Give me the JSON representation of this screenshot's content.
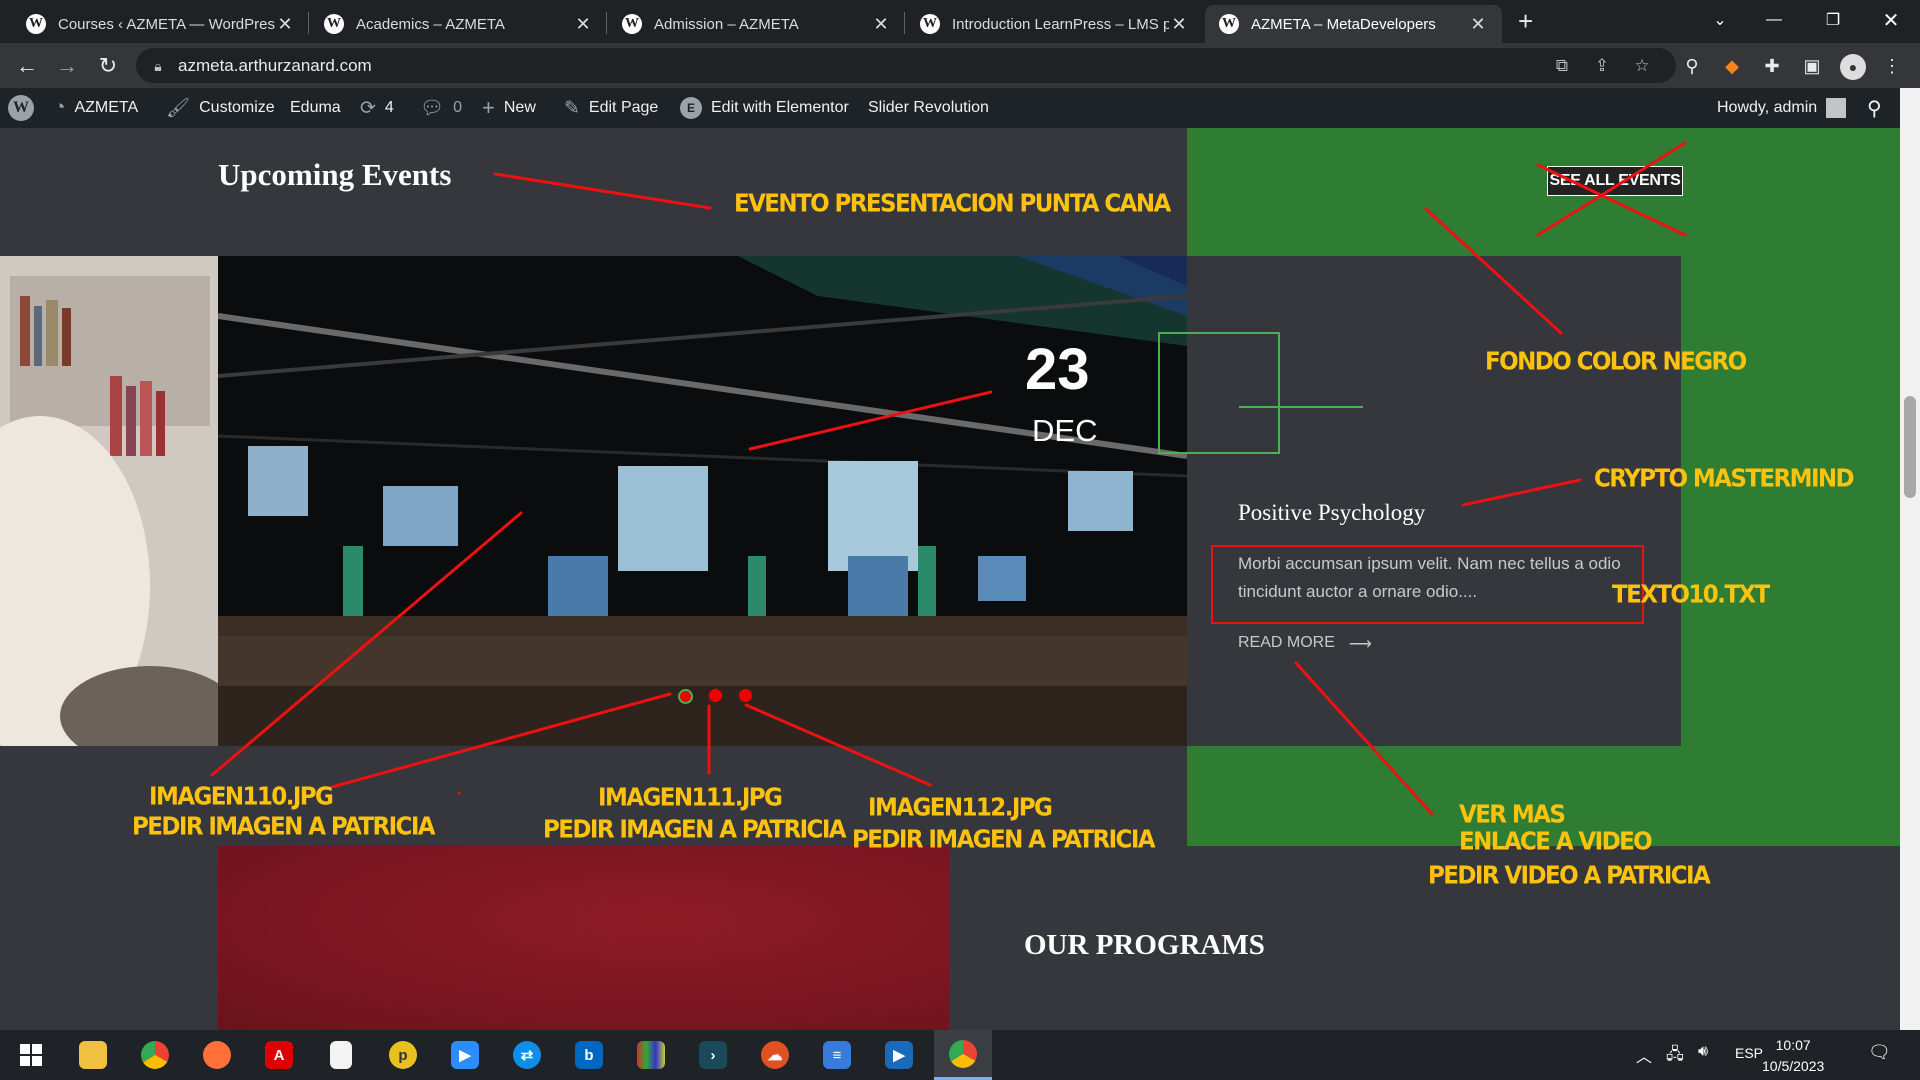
{
  "browser": {
    "tabs": [
      {
        "title": "Courses ‹ AZMETA — WordPress"
      },
      {
        "title": "Academics – AZMETA"
      },
      {
        "title": "Admission – AZMETA"
      },
      {
        "title": "Introduction LearnPress – LMS pl"
      },
      {
        "title": "AZMETA – MetaDevelopers",
        "active": true
      }
    ],
    "url": "azmeta.arthurzanard.com"
  },
  "admin_bar": {
    "site": "AZMETA",
    "customize": "Customize",
    "theme": "Eduma",
    "updates": "4",
    "comments": "0",
    "new": "New",
    "edit_page": "Edit Page",
    "elementor": "Edit with Elementor",
    "slider": "Slider Revolution",
    "howdy": "Howdy, admin"
  },
  "events": {
    "heading": "Upcoming Events",
    "see_all": "SEE ALL EVENTS",
    "day": "23",
    "month": "DEC",
    "title": "Positive Psychology",
    "description": "Morbi accumsan ipsum velit. Nam nec tellus a odio tincidunt auctor a ornare odio....",
    "read_more": "READ MORE",
    "read_more_arrow": "⟶"
  },
  "programs": {
    "heading": "OUR PROGRAMS"
  },
  "annotations": {
    "evento": "EVENTO PRESENTACION PUNTA CANA",
    "fondo": "FONDO COLOR NEGRO",
    "crypto": "CRYPTO MASTERMIND",
    "texto": "TEXTO10.TXT",
    "img110": "IMAGEN110.JPG",
    "img110_b": "PEDIR IMAGEN A PATRICIA",
    "img111": "IMAGEN111.JPG",
    "img111_b": "PEDIR IMAGEN A PATRICIA",
    "img112": "IMAGEN112.JPG",
    "img112_b": "PEDIR IMAGEN A PATRICIA",
    "vermas": "VER MAS",
    "enlace": "ENLACE A VIDEO",
    "pedirvideo": "PEDIR VIDEO A PATRICIA"
  },
  "colors": {
    "annotation": "#ffc20e",
    "accent_green": "#2f7d32",
    "marker_red": "#ee1111"
  },
  "taskbar": {
    "language": "ESP",
    "time": "10:07",
    "date": "10/5/2023"
  }
}
